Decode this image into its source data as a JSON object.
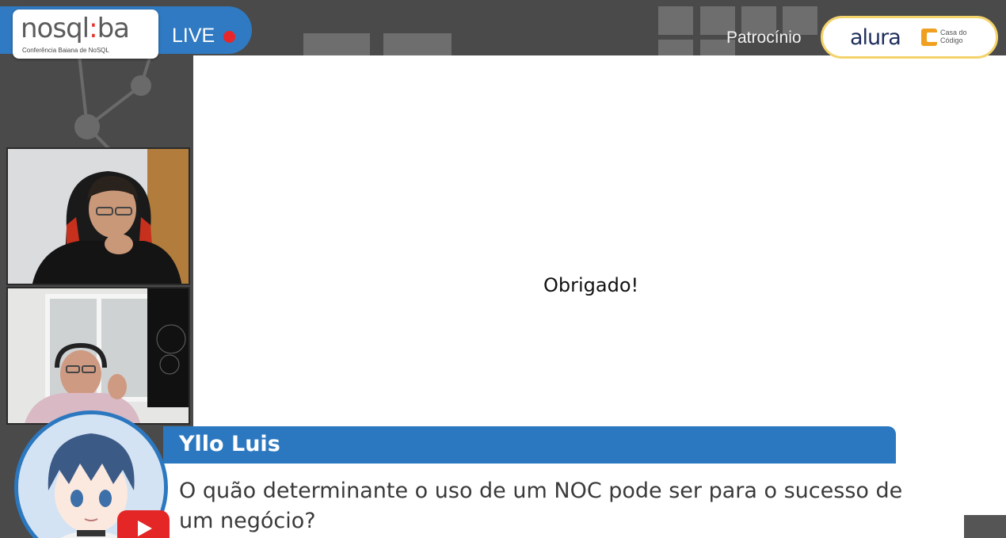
{
  "header": {
    "logo": {
      "text_main": "nosql",
      "text_sep": ":",
      "text_accent": "ba",
      "subtitle": "Conferência Baiana de NoSQL"
    },
    "live_label": "LIVE",
    "sponsor_label": "Patrocínio",
    "sponsors": {
      "alura": "alura",
      "casa_do_codigo": "Casa do Código"
    }
  },
  "slide": {
    "text": "Obrigado!"
  },
  "lower_third": {
    "name": "Yllo Luis",
    "question": "O quão determinante o uso de um NOC pode ser para o sucesso de um negócio?"
  },
  "colors": {
    "brand_blue": "#2c78c0",
    "live_red": "#e8262a",
    "sponsor_border": "#f4d36a",
    "background": "#4a4a4a"
  },
  "icons": [
    "live-dot-icon",
    "casa-do-codigo-icon",
    "youtube-icon"
  ]
}
